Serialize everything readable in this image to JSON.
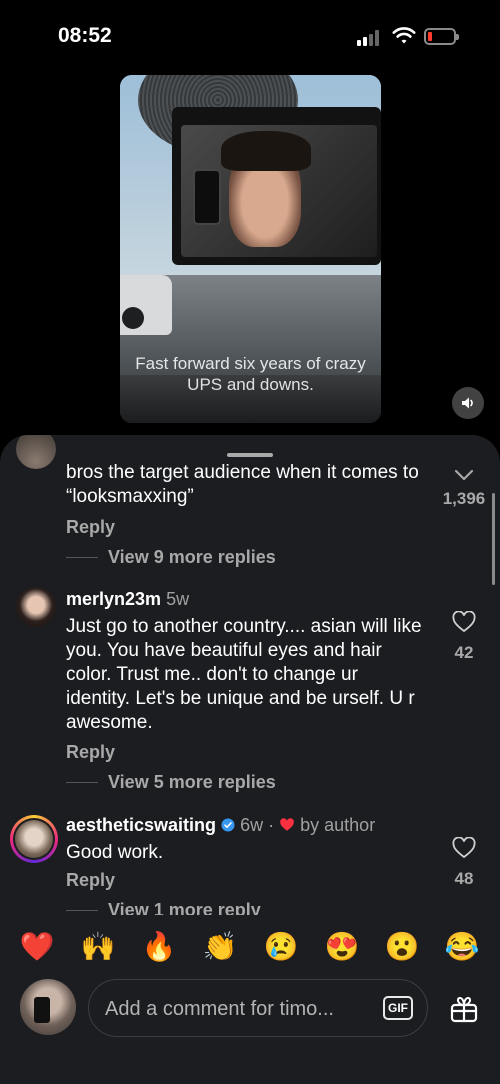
{
  "status_bar": {
    "time": "08:52"
  },
  "video": {
    "caption": "Fast forward six years of crazy UPS and downs."
  },
  "comments": [
    {
      "body": "bros the target audience when it comes to “looksmaxxing”",
      "reply_label": "Reply",
      "like_count": "1,396",
      "more_replies": "View 9 more replies"
    },
    {
      "username": "merlyn23m",
      "age": "5w",
      "body": "Just go to another country.... asian will like you. You have beautiful eyes and hair color.  Trust me.. don't to change ur identity.  Let's be unique and be urself. U r awesome.",
      "reply_label": "Reply",
      "like_count": "42",
      "more_replies": "View 5 more replies"
    },
    {
      "username": "aestheticswaiting",
      "age": "6w",
      "separator": "·",
      "liked_by": "by author",
      "body": "Good work.",
      "reply_label": "Reply",
      "like_count": "48",
      "more_replies": "View 1 more reply"
    }
  ],
  "emojis": [
    "❤️",
    "🙌",
    "🔥",
    "👏",
    "😢",
    "😍",
    "😮",
    "😂"
  ],
  "composer": {
    "placeholder": "Add a comment for timo...",
    "gif_label": "GIF"
  },
  "colors": {
    "sheet_bg": "#1c1d20",
    "verified": "#3897f0",
    "heart_red": "#ff3040",
    "battery_low": "#ff3b30"
  }
}
